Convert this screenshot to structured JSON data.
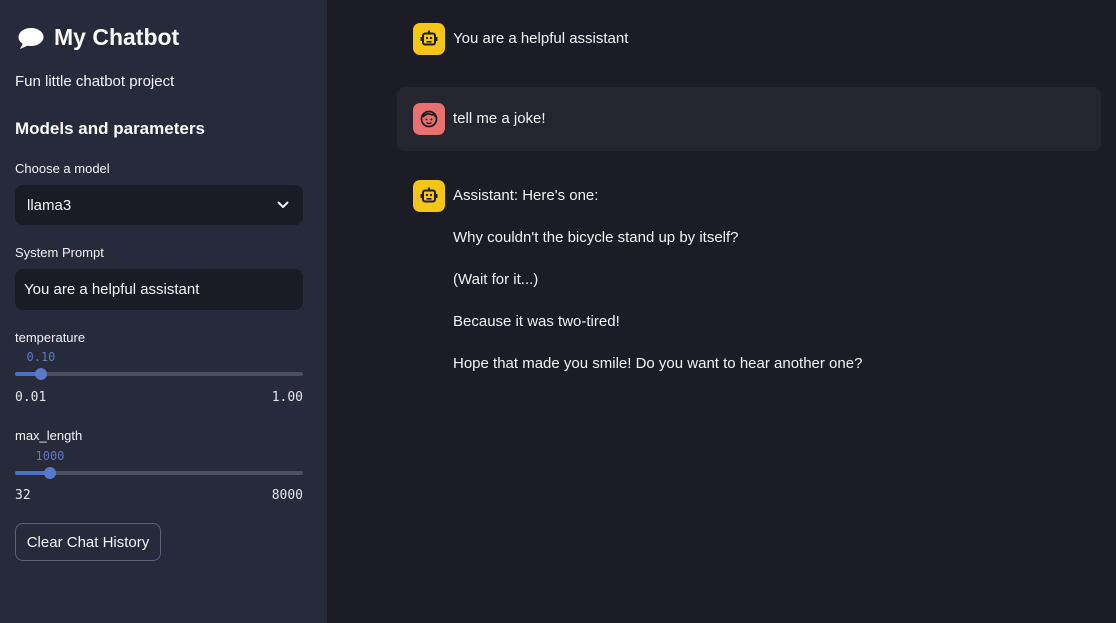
{
  "sidebar": {
    "title": "My Chatbot",
    "title_icon": "speech-bubble-icon",
    "subtitle": "Fun little chatbot project",
    "section_heading": "Models and parameters",
    "model": {
      "label": "Choose a model",
      "selected": "llama3"
    },
    "system_prompt": {
      "label": "System Prompt",
      "value": "You are a helpful assistant"
    },
    "temperature": {
      "label": "temperature",
      "value": "0.10",
      "min": "0.01",
      "max": "1.00",
      "fraction": 0.091
    },
    "max_length": {
      "label": "max_length",
      "value": "1000",
      "min": "32",
      "max": "8000",
      "fraction": 0.121
    },
    "clear_button_label": "Clear Chat History"
  },
  "chat": {
    "messages": [
      {
        "role": "assistant",
        "avatar_icon": "robot-icon",
        "lines": [
          "You are a helpful assistant"
        ]
      },
      {
        "role": "user",
        "avatar_icon": "face-icon",
        "lines": [
          "tell me a joke!"
        ]
      },
      {
        "role": "assistant",
        "avatar_icon": "robot-icon",
        "lines": [
          "Assistant: Here's one:",
          "Why couldn't the bicycle stand up by itself?",
          "(Wait for it...)",
          "Because it was two-tired!",
          "Hope that made you smile! Do you want to hear another one?"
        ]
      }
    ]
  },
  "colors": {
    "sidebar_bg": "#272a3a",
    "main_bg": "#1b1c25",
    "bot_avatar": "#f5c518",
    "user_avatar": "#e8716f",
    "slider_accent": "#4d6fc0"
  }
}
